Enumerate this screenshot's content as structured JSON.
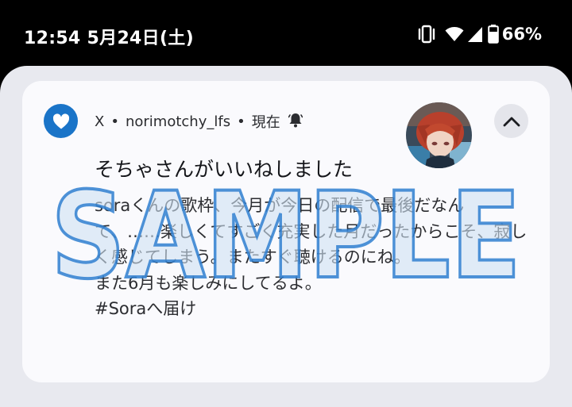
{
  "status_bar": {
    "time": "12:54",
    "date": "5月24日(土)",
    "battery_percent": "66%",
    "icons": [
      "vibrate-icon",
      "wifi-icon",
      "cell-signal-icon",
      "battery-icon"
    ]
  },
  "notification": {
    "app_name": "X",
    "separator": "•",
    "account": "norimotchy_lfs",
    "time": "現在",
    "title": "そちゃさんがいいねしました",
    "body": "soraくんの歌枠、今月が今日の配信で最後だなんて、……楽しくてすごく充実した月だったからこそ、寂しく感じてしまう。またすぐ聴けるのにね。\nまた6月も楽しみにしてるよ。\n#Soraへ届け",
    "app_icon": "heart-icon",
    "alert_icon": "bell-icon",
    "collapse_icon": "chevron-up-icon"
  },
  "watermark": "SAMPLE",
  "colors": {
    "app_icon_bg": "#1a74c8",
    "card_bg": "#fafafd",
    "shade_bg": "#e8e9ef",
    "watermark_fill": "#cfe1f4",
    "watermark_stroke": "#2f7fd0"
  }
}
